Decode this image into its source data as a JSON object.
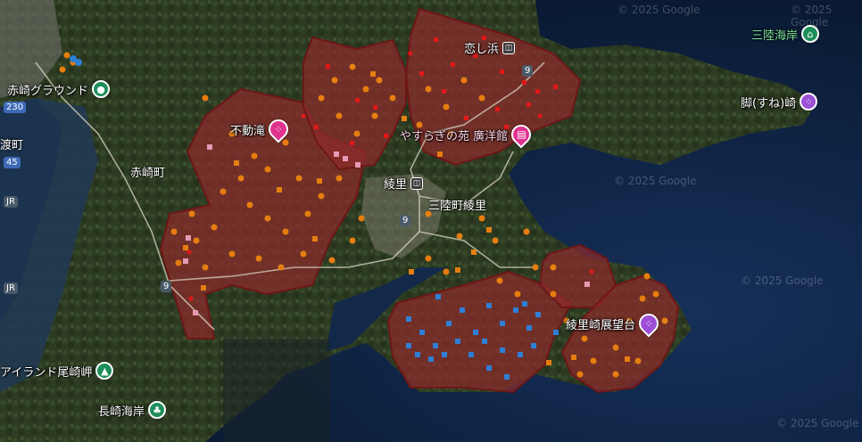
{
  "map": {
    "watermark": "© 2025 Google",
    "pois": {
      "akasaki_ground": "赤崎グラウンド",
      "fudotaki": "不動滝",
      "koishihama": "恋し浜",
      "yasuragi": "やすらぎの苑 廣洋館",
      "ryori": "綾里",
      "sanriku_ryori": "三陸町綾里",
      "akasaki_cho": "赤崎町",
      "sanriku_kaigan": "三陸海岸",
      "sune_zaki": "脚(すね)崎",
      "ryorizaki": "綾里崎展望台",
      "island_ozaki": "アイランド尾崎岬",
      "nagasaki_kaigan": "長崎海岸",
      "watari_cho": "渡町"
    },
    "shields": {
      "r230": "230",
      "r45": "45",
      "r9a": "9",
      "r9b": "9",
      "r9c": "9",
      "jr1": "JR",
      "jr2": "JR"
    },
    "colors": {
      "sea": "#0c1f3c",
      "land": "#2c3a22",
      "zone_fill": "#8c2b2b",
      "zone_stroke": "#6e1616",
      "marker_orange": "#e67e0f",
      "marker_red": "#e01818",
      "marker_blue": "#2f7fd6",
      "marker_pink": "#e79ab3"
    },
    "legend_none": ""
  }
}
